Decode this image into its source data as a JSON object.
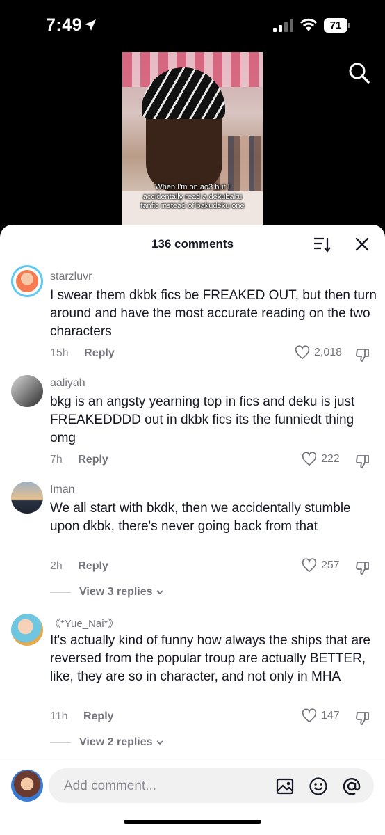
{
  "status_bar": {
    "time": "7:49",
    "battery": "71",
    "icons": [
      "location-arrow-icon",
      "signal-icon",
      "wifi-icon",
      "battery-icon"
    ]
  },
  "video": {
    "caption": "When I'm on ao3 but I accidentally read a dekubaku fanfic instead of bakudeku one"
  },
  "top_actions": {
    "search_icon": "search-icon"
  },
  "sheet": {
    "title": "136 comments",
    "sort_icon": "sort-icon",
    "close_icon": "close-icon"
  },
  "comments": [
    {
      "username": "starzluvr",
      "text": "I swear them dkbk fics be FREAKED OUT, but then turn around and have the most accurate reading on the two characters",
      "time": "15h",
      "reply_label": "Reply",
      "likes": "2,018",
      "colors": {
        "avatar_ring": "#5ec8f0",
        "avatar_bg": "#f47b52"
      }
    },
    {
      "username": "aaliyah",
      "text": "bkg is an angsty yearning top in fics and deku is just FREAKEDDDD out in dkbk fics its the funniedt thing omg",
      "time": "7h",
      "reply_label": "Reply",
      "likes": "222",
      "colors": {
        "avatar_bg": "#3a3a3a"
      }
    },
    {
      "username": "Iman",
      "text": "We all start with bkdk, then we accidentally stumble upon dkbk, there's never going back from that",
      "time": "2h",
      "reply_label": "Reply",
      "likes": "257",
      "view_replies": "View 3 replies",
      "colors": {
        "avatar_bg": "#6a7a90"
      }
    },
    {
      "username": "《*Yue_Nai*》",
      "text": "It's actually kind of funny how always the ships that are reversed from the popular troup are actually BETTER, like, they are so in character, and not only in MHA",
      "time": "11h",
      "reply_label": "Reply",
      "likes": "147",
      "view_replies": "View 2 replies",
      "colors": {
        "avatar_bg": "#6ec6e0"
      }
    }
  ],
  "composer": {
    "placeholder": "Add comment...",
    "icons": [
      "image-icon",
      "emoji-icon",
      "mention-icon"
    ]
  }
}
